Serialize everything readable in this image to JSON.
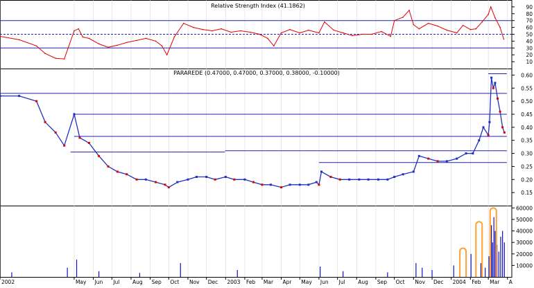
{
  "chart_data": [
    {
      "type": "line",
      "title": "Relative Strength Index (41.1862)",
      "ylim": [
        0,
        100
      ],
      "yticks": [
        10,
        20,
        30,
        40,
        50,
        60,
        70,
        80,
        90
      ],
      "reference_lines": [
        30,
        50,
        70
      ],
      "series": [
        {
          "color": "#e00000",
          "x": [
            "2002-01-01",
            "2002-02-01",
            "2002-03-01",
            "2002-03-15",
            "2002-04-01",
            "2002-04-15",
            "2002-05-01",
            "2002-05-08",
            "2002-05-15",
            "2002-05-25",
            "2002-06-10",
            "2002-06-25",
            "2002-07-10",
            "2002-07-25",
            "2002-08-10",
            "2002-08-25",
            "2002-09-10",
            "2002-09-20",
            "2002-09-28",
            "2002-10-10",
            "2002-10-25",
            "2002-11-10",
            "2002-11-25",
            "2002-12-10",
            "2002-12-25",
            "2003-01-10",
            "2003-01-25",
            "2003-02-10",
            "2003-02-25",
            "2003-03-10",
            "2003-03-20",
            "2003-04-01",
            "2003-04-15",
            "2003-05-01",
            "2003-05-15",
            "2003-06-01",
            "2003-06-10",
            "2003-06-25",
            "2003-07-10",
            "2003-07-25",
            "2003-08-10",
            "2003-08-25",
            "2003-09-10",
            "2003-09-25",
            "2003-10-01",
            "2003-10-15",
            "2003-10-25",
            "2003-11-01",
            "2003-11-10",
            "2003-11-25",
            "2003-12-10",
            "2003-12-25",
            "2004-01-10",
            "2004-01-20",
            "2004-02-01",
            "2004-02-10",
            "2004-02-20",
            "2004-03-01",
            "2004-03-05",
            "2004-03-12",
            "2004-03-20",
            "2004-03-26"
          ],
          "values": [
            47,
            42,
            33,
            22,
            15,
            14,
            55,
            58,
            46,
            44,
            36,
            31,
            34,
            38,
            41,
            44,
            40,
            33,
            20,
            46,
            66,
            60,
            57,
            55,
            58,
            53,
            55,
            53,
            50,
            44,
            33,
            52,
            57,
            52,
            56,
            52,
            68,
            56,
            52,
            48,
            50,
            50,
            54,
            47,
            70,
            75,
            85,
            64,
            58,
            66,
            62,
            56,
            52,
            63,
            57,
            58,
            68,
            79,
            90,
            74,
            60,
            43
          ]
        }
      ]
    },
    {
      "type": "line",
      "title": "PARAREDE (0.47000, 0.47000, 0.37000, 0.38000, -0.10000)",
      "ylim": [
        0.1,
        0.6
      ],
      "yticks": [
        0.15,
        0.2,
        0.25,
        0.3,
        0.35,
        0.4,
        0.45,
        0.5,
        0.55,
        0.6
      ],
      "series": [
        {
          "color": "#2030c0",
          "x": [
            "2002-01-01",
            "2002-02-01",
            "2002-03-01",
            "2002-03-15",
            "2002-04-01",
            "2002-04-15",
            "2002-05-01",
            "2002-05-10",
            "2002-05-25",
            "2002-06-10",
            "2002-06-25",
            "2002-07-10",
            "2002-07-25",
            "2002-08-10",
            "2002-08-25",
            "2002-09-10",
            "2002-09-25",
            "2002-10-01",
            "2002-10-15",
            "2002-11-01",
            "2002-11-15",
            "2002-12-01",
            "2002-12-15",
            "2003-01-01",
            "2003-01-15",
            "2003-02-01",
            "2003-02-15",
            "2003-03-01",
            "2003-03-15",
            "2003-04-01",
            "2003-04-15",
            "2003-05-01",
            "2003-05-15",
            "2003-05-28",
            "2003-06-01",
            "2003-06-05",
            "2003-06-20",
            "2003-07-05",
            "2003-07-20",
            "2003-08-05",
            "2003-08-20",
            "2003-09-05",
            "2003-09-20",
            "2003-10-01",
            "2003-10-15",
            "2003-11-01",
            "2003-11-10",
            "2003-11-25",
            "2003-12-10",
            "2003-12-25",
            "2004-01-10",
            "2004-01-25",
            "2004-02-05",
            "2004-02-15",
            "2004-02-22",
            "2004-03-01",
            "2004-03-03",
            "2004-03-06",
            "2004-03-09",
            "2004-03-12",
            "2004-03-16",
            "2004-03-20",
            "2004-03-24",
            "2004-03-27"
          ],
          "values": [
            0.52,
            0.52,
            0.5,
            0.42,
            0.38,
            0.33,
            0.45,
            0.36,
            0.34,
            0.29,
            0.25,
            0.23,
            0.22,
            0.2,
            0.2,
            0.19,
            0.18,
            0.17,
            0.19,
            0.2,
            0.21,
            0.21,
            0.2,
            0.21,
            0.2,
            0.2,
            0.19,
            0.18,
            0.18,
            0.17,
            0.18,
            0.18,
            0.18,
            0.19,
            0.18,
            0.23,
            0.21,
            0.2,
            0.2,
            0.2,
            0.2,
            0.2,
            0.2,
            0.21,
            0.22,
            0.23,
            0.29,
            0.28,
            0.27,
            0.27,
            0.28,
            0.3,
            0.3,
            0.35,
            0.4,
            0.37,
            0.42,
            0.59,
            0.55,
            0.57,
            0.51,
            0.46,
            0.4,
            0.38
          ]
        }
      ],
      "reference_lines": [
        {
          "value": 0.53,
          "from": "2002-01-01",
          "to": "2004-03-31"
        },
        {
          "value": 0.45,
          "from": "2002-05-01",
          "to": "2004-03-31"
        },
        {
          "value": 0.365,
          "from": "2002-05-01",
          "to": "2004-03-31"
        },
        {
          "value": 0.305,
          "from": "2002-04-25",
          "to": "2002-12-31"
        },
        {
          "value": 0.31,
          "from": "2002-12-31",
          "to": "2004-03-31"
        },
        {
          "value": 0.265,
          "from": "2003-06-01",
          "to": "2004-03-31"
        },
        {
          "value": 0.605,
          "from": "2004-03-01",
          "to": "2004-03-31"
        }
      ]
    },
    {
      "type": "bar",
      "ylim": [
        0,
        60000
      ],
      "yticks": [
        10000,
        20000,
        30000,
        40000,
        50000,
        60000
      ],
      "color": "#1010c0",
      "highlight_color": "#ffa030",
      "x": [
        "2002-01-20",
        "2002-04-20",
        "2002-05-05",
        "2002-06-10",
        "2002-08-15",
        "2002-10-20",
        "2003-01-20",
        "2003-06-03",
        "2003-07-10",
        "2003-09-20",
        "2003-11-05",
        "2003-11-15",
        "2003-12-01",
        "2004-01-05",
        "2004-01-25",
        "2004-02-02",
        "2004-02-10",
        "2004-02-18",
        "2004-02-25",
        "2004-03-02",
        "2004-03-04",
        "2004-03-06",
        "2004-03-08",
        "2004-03-10",
        "2004-03-12",
        "2004-03-15",
        "2004-03-18",
        "2004-03-21",
        "2004-03-24",
        "2004-03-27"
      ],
      "values": [
        4000,
        8000,
        15000,
        5000,
        3500,
        12000,
        6000,
        9000,
        5000,
        4000,
        12000,
        8000,
        6000,
        10000,
        9000,
        20000,
        25000,
        12000,
        8000,
        18000,
        55000,
        45000,
        30000,
        52000,
        40000,
        28000,
        22000,
        35000,
        40000,
        30000
      ],
      "highlighted": [
        {
          "x": "2004-01-20",
          "value": 25000
        },
        {
          "x": "2004-02-15",
          "value": 48000
        },
        {
          "x": "2004-03-09",
          "value": 60000
        }
      ]
    }
  ],
  "x_axis": {
    "ticks": [
      {
        "label": "2002",
        "date": "2002-01-01"
      },
      {
        "label": "May",
        "date": "2002-05-01"
      },
      {
        "label": "Jun",
        "date": "2002-06-01"
      },
      {
        "label": "Jul",
        "date": "2002-07-01"
      },
      {
        "label": "Aug",
        "date": "2002-08-01"
      },
      {
        "label": "Sep",
        "date": "2002-09-01"
      },
      {
        "label": "Oct",
        "date": "2002-10-01"
      },
      {
        "label": "Nov",
        "date": "2002-11-01"
      },
      {
        "label": "Dec",
        "date": "2002-12-01"
      },
      {
        "label": "2003",
        "date": "2003-01-01"
      },
      {
        "label": "Feb",
        "date": "2003-02-01"
      },
      {
        "label": "Mar",
        "date": "2003-03-01"
      },
      {
        "label": "Apr",
        "date": "2003-04-01"
      },
      {
        "label": "May",
        "date": "2003-05-01"
      },
      {
        "label": "Jun",
        "date": "2003-06-01"
      },
      {
        "label": "Jul",
        "date": "2003-07-01"
      },
      {
        "label": "Aug",
        "date": "2003-08-01"
      },
      {
        "label": "Sep",
        "date": "2003-09-01"
      },
      {
        "label": "Oct",
        "date": "2003-10-01"
      },
      {
        "label": "Nov",
        "date": "2003-11-01"
      },
      {
        "label": "Dec",
        "date": "2003-12-01"
      },
      {
        "label": "2004",
        "date": "2004-01-01"
      },
      {
        "label": "Feb",
        "date": "2004-02-01"
      },
      {
        "label": "Mar",
        "date": "2004-03-01"
      },
      {
        "label": "A",
        "date": "2004-04-01"
      }
    ]
  },
  "colors": {
    "grid": "#000000",
    "rsi_line": "#e00000",
    "price_line": "#2030c0",
    "volume_bar": "#1010c0",
    "highlight": "#ffa030"
  }
}
